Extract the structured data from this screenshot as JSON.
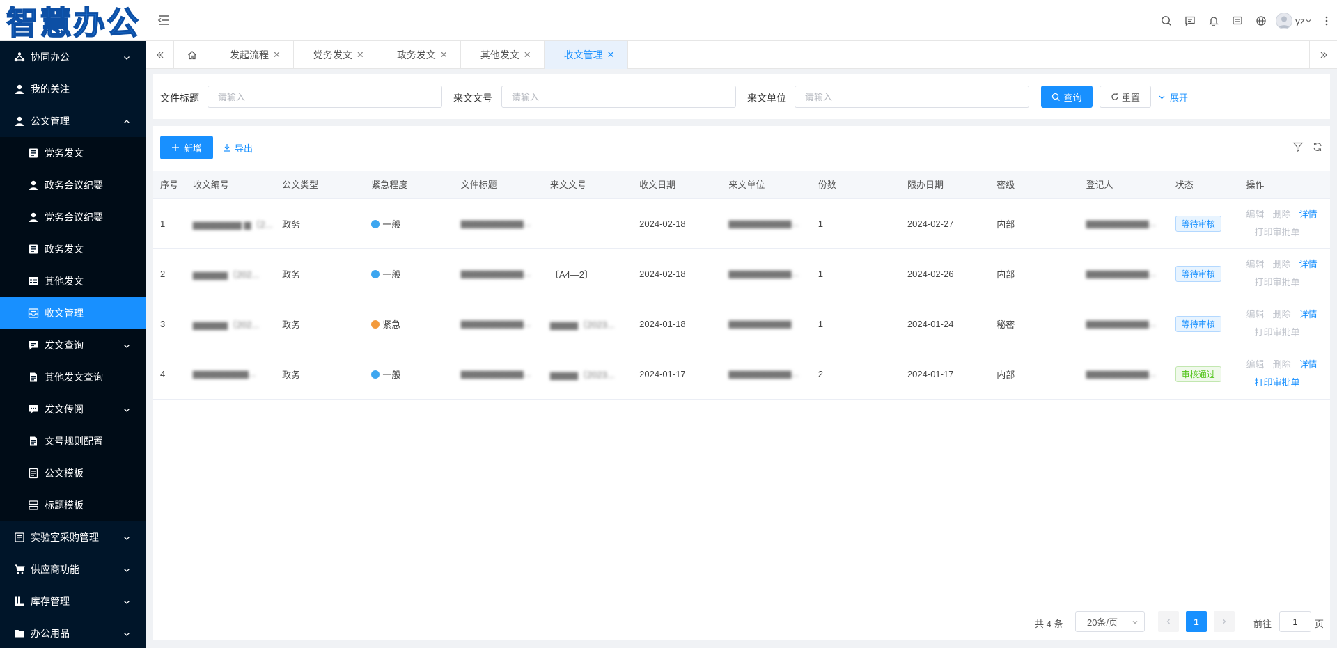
{
  "app": {
    "logo_text": "智慧办公",
    "username": "yz"
  },
  "sidebar": {
    "items": [
      {
        "label": "协同办公",
        "icon": "network-icon",
        "level": "top",
        "arrow": "down"
      },
      {
        "label": "我的关注",
        "icon": "user-icon",
        "level": "top",
        "arrow": ""
      },
      {
        "label": "公文管理",
        "icon": "user-icon",
        "level": "top",
        "arrow": "up"
      },
      {
        "label": "党务发文",
        "icon": "doc-icon",
        "level": "sub",
        "arrow": ""
      },
      {
        "label": "政务会议纪要",
        "icon": "user-icon",
        "level": "sub",
        "arrow": ""
      },
      {
        "label": "党务会议纪要",
        "icon": "user-icon",
        "level": "sub",
        "arrow": ""
      },
      {
        "label": "政务发文",
        "icon": "doc-icon",
        "level": "sub",
        "arrow": ""
      },
      {
        "label": "其他发文",
        "icon": "table-icon",
        "level": "sub",
        "arrow": ""
      },
      {
        "label": "收文管理",
        "icon": "inbox-icon",
        "level": "sub",
        "arrow": "",
        "active": true
      },
      {
        "label": "发文查询",
        "icon": "message-icon",
        "level": "sub",
        "arrow": "down"
      },
      {
        "label": "其他发文查询",
        "icon": "file-icon",
        "level": "sub",
        "arrow": ""
      },
      {
        "label": "发文传阅",
        "icon": "chat-icon",
        "level": "sub",
        "arrow": "down"
      },
      {
        "label": "文号规则配置",
        "icon": "file-icon",
        "level": "sub",
        "arrow": ""
      },
      {
        "label": "公文模板",
        "icon": "template-icon",
        "level": "sub",
        "arrow": ""
      },
      {
        "label": "标题模板",
        "icon": "layers-icon",
        "level": "sub",
        "arrow": ""
      },
      {
        "label": "实验室采购管理",
        "icon": "list-icon",
        "level": "top",
        "arrow": "down"
      },
      {
        "label": "供应商功能",
        "icon": "cart-icon",
        "level": "top",
        "arrow": "down"
      },
      {
        "label": "库存管理",
        "icon": "book-icon",
        "level": "top",
        "arrow": "down"
      },
      {
        "label": "办公用品",
        "icon": "folder-icon",
        "level": "top",
        "arrow": "down"
      }
    ]
  },
  "tabs": [
    {
      "label": "发起流程",
      "active": false
    },
    {
      "label": "党务发文",
      "active": false
    },
    {
      "label": "政务发文",
      "active": false
    },
    {
      "label": "其他发文",
      "active": false
    },
    {
      "label": "收文管理",
      "active": true
    }
  ],
  "search": {
    "title_label": "文件标题",
    "title_placeholder": "请输入",
    "docno_label": "来文文号",
    "docno_placeholder": "请输入",
    "unit_label": "来文单位",
    "unit_placeholder": "请输入",
    "query_label": "查询",
    "reset_label": "重置",
    "expand_label": "展开"
  },
  "toolbar": {
    "add_label": "新增",
    "export_label": "导出"
  },
  "table": {
    "columns": [
      "序号",
      "收文编号",
      "公文类型",
      "紧急程度",
      "文件标题",
      "来文文号",
      "收文日期",
      "来文单位",
      "份数",
      "限办日期",
      "密级",
      "登记人",
      "状态",
      "操作"
    ],
    "rows": [
      {
        "no": "1",
        "code": "▆▆▆▆▆▆▆ ▆〔2...",
        "type": "政务",
        "urgency": "一般",
        "urgency_color": "#3ca6f0",
        "title": "▆▆▆▆▆▆▆▆▆...",
        "docno": "",
        "date": "2024-02-18",
        "unit": "▆▆▆▆▆▆▆▆▆...",
        "copies": "1",
        "deadline": "2024-02-27",
        "secret": "内部",
        "registrar": "▆▆▆▆▆▆▆▆▆...",
        "status": "等待审核",
        "status_type": "pending",
        "print_active": false
      },
      {
        "no": "2",
        "code": "▆▆▆▆▆〔202...",
        "type": "政务",
        "urgency": "一般",
        "urgency_color": "#3ca6f0",
        "title": "▆▆▆▆▆▆▆▆▆...",
        "docno": "〔A4—2〕",
        "date": "2024-02-18",
        "unit": "▆▆▆▆▆▆▆▆▆...",
        "copies": "1",
        "deadline": "2024-02-26",
        "secret": "内部",
        "registrar": "▆▆▆▆▆▆▆▆▆...",
        "status": "等待审核",
        "status_type": "pending",
        "print_active": false
      },
      {
        "no": "3",
        "code": "▆▆▆▆▆〔202...",
        "type": "政务",
        "urgency": "紧急",
        "urgency_color": "#f39a3c",
        "title": "▆▆▆▆▆▆▆▆▆...",
        "docno": "▆▆▆▆〔2023...",
        "date": "2024-01-18",
        "unit": "▆▆▆▆▆▆▆▆▆",
        "copies": "1",
        "deadline": "2024-01-24",
        "secret": "秘密",
        "registrar": "▆▆▆▆▆▆▆▆▆...",
        "status": "等待审核",
        "status_type": "pending",
        "print_active": false
      },
      {
        "no": "4",
        "code": "▆▆▆▆▆▆▆▆...",
        "type": "政务",
        "urgency": "一般",
        "urgency_color": "#3ca6f0",
        "title": "▆▆▆▆▆▆▆▆▆...",
        "docno": "▆▆▆▆〔2023...",
        "date": "2024-01-17",
        "unit": "▆▆▆▆▆▆▆▆▆...",
        "copies": "2",
        "deadline": "2024-01-17",
        "secret": "内部",
        "registrar": "▆▆▆▆▆▆▆▆▆...",
        "status": "审核通过",
        "status_type": "pass",
        "print_active": true
      }
    ],
    "ops": {
      "edit": "编辑",
      "delete": "删除",
      "detail": "详情",
      "print": "打印审批单"
    }
  },
  "pagination": {
    "total_text": "共 4 条",
    "page_size": "20条/页",
    "current_page": "1",
    "goto_label": "前往",
    "goto_value": "1",
    "page_label": "页"
  },
  "colors": {
    "primary": "#1890ff",
    "sidebar_bg": "#001529",
    "sidebar_sub_bg": "#000c17"
  }
}
